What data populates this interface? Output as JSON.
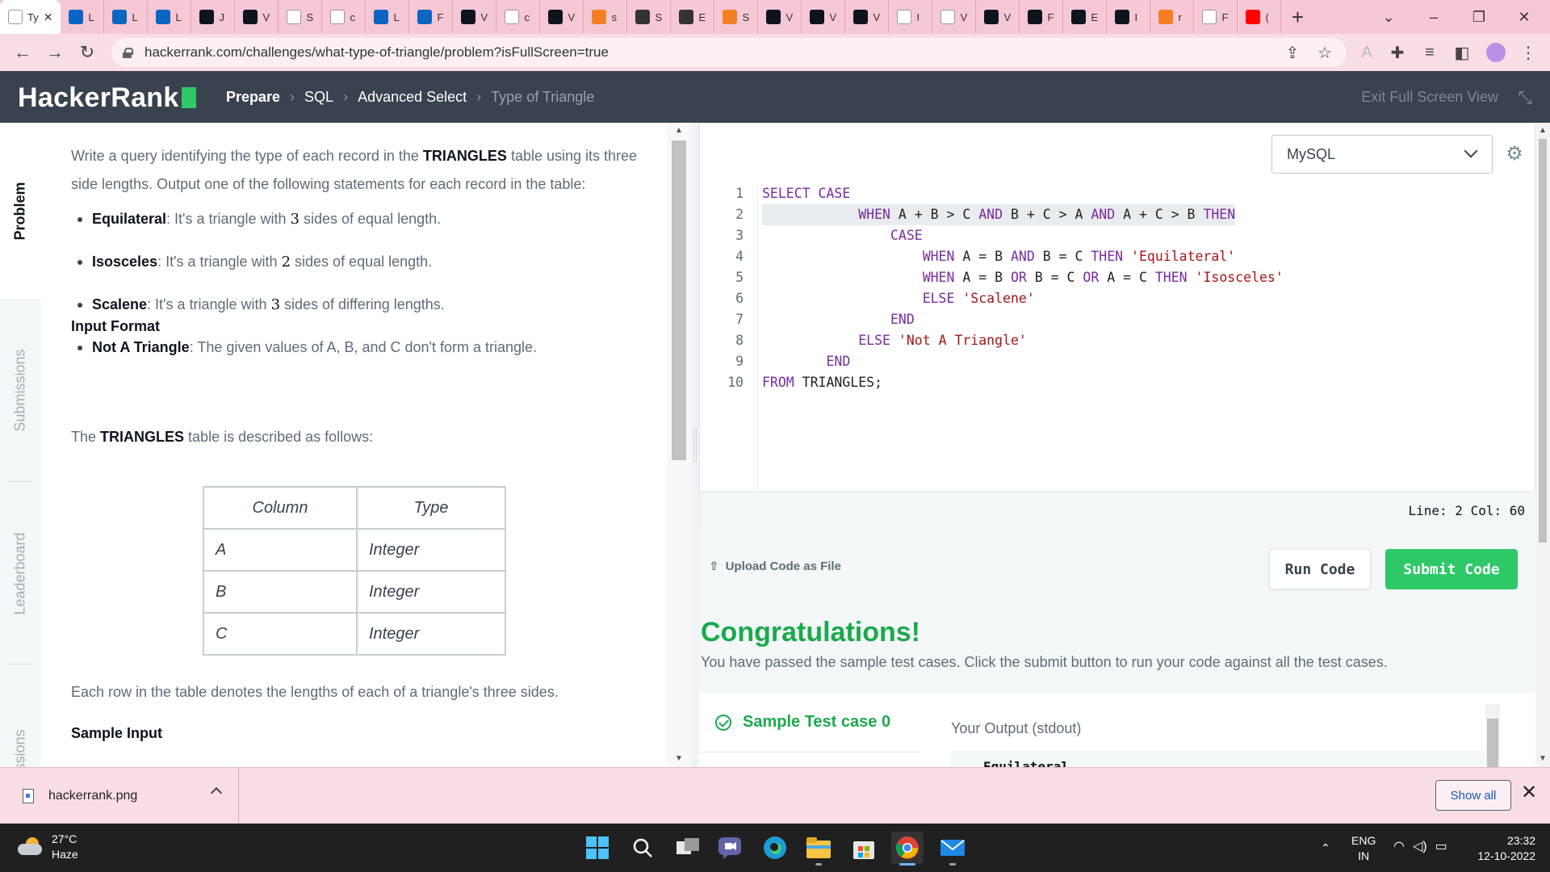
{
  "browser": {
    "tabs": [
      {
        "icon": "hackerrank-tab-icon",
        "label": "Ty",
        "color": "#ffffff",
        "active": true
      },
      {
        "icon": "linkedin-icon",
        "label": "L",
        "color": "#0a66c2"
      },
      {
        "icon": "linkedin-icon",
        "label": "L",
        "color": "#0a66c2"
      },
      {
        "icon": "linkedin-icon",
        "label": "L",
        "color": "#0a66c2"
      },
      {
        "icon": "hackerrank-icon",
        "label": "J",
        "color": "#0e141e"
      },
      {
        "icon": "hackerrank-icon",
        "label": "V",
        "color": "#0e141e"
      },
      {
        "icon": "github-icon",
        "label": "S",
        "color": "#ffffff"
      },
      {
        "icon": "google-icon",
        "label": "c",
        "color": "#ffffff"
      },
      {
        "icon": "linkedin-icon",
        "label": "L",
        "color": "#0a66c2"
      },
      {
        "icon": "linkedin-icon",
        "label": "F",
        "color": "#0a66c2"
      },
      {
        "icon": "hackerrank-icon",
        "label": "V",
        "color": "#0e141e"
      },
      {
        "icon": "google-icon",
        "label": "c",
        "color": "#ffffff"
      },
      {
        "icon": "hackerrank-icon",
        "label": "V",
        "color": "#0e141e"
      },
      {
        "icon": "stackoverflow-icon",
        "label": "s",
        "color": "#f48024"
      },
      {
        "icon": "gear-icon",
        "label": "S",
        "color": "#333333"
      },
      {
        "icon": "puzzle-icon",
        "label": "E",
        "color": "#333333"
      },
      {
        "icon": "stackoverflow-icon",
        "label": "S",
        "color": "#f48024"
      },
      {
        "icon": "hackerrank-icon",
        "label": "V",
        "color": "#0e141e"
      },
      {
        "icon": "hackerrank-icon",
        "label": "V",
        "color": "#0e141e"
      },
      {
        "icon": "hackerrank-icon",
        "label": "V",
        "color": "#0e141e"
      },
      {
        "icon": "google-icon",
        "label": "I",
        "color": "#ffffff"
      },
      {
        "icon": "google-icon",
        "label": "V",
        "color": "#ffffff"
      },
      {
        "icon": "hackerrank-icon",
        "label": "V",
        "color": "#0e141e"
      },
      {
        "icon": "hackerrank-icon",
        "label": "F",
        "color": "#0e141e"
      },
      {
        "icon": "hackerrank-icon",
        "label": "E",
        "color": "#0e141e"
      },
      {
        "icon": "hackerrank-icon",
        "label": "I",
        "color": "#0e141e"
      },
      {
        "icon": "stackoverflow-icon",
        "label": "r",
        "color": "#f48024"
      },
      {
        "icon": "github-icon",
        "label": "F",
        "color": "#ffffff"
      },
      {
        "icon": "youtube-icon",
        "label": "(",
        "color": "#ff0000"
      }
    ],
    "close_tab_glyph": "✕",
    "new_tab_glyph": "+",
    "url": "hackerrank.com/challenges/what-type-of-triangle/problem?isFullScreen=true"
  },
  "header": {
    "logo_text": "HackerRank",
    "breadcrumb": [
      "Prepare",
      "SQL",
      "Advanced Select",
      "Type of Triangle"
    ],
    "breadcrumb_sep": "›",
    "exit_fullscreen": "Exit Full Screen View"
  },
  "side_tabs": [
    "Problem",
    "Submissions",
    "Leaderboard",
    "Discussions"
  ],
  "problem": {
    "intro_pre": "Write a query identifying the type of each record in the ",
    "intro_table": "TRIANGLES",
    "intro_post": " table using its three side lengths. Output one of the following statements for each record in the table:",
    "items": [
      {
        "term": "Equilateral",
        "pre": ": It's a triangle with ",
        "num": "3",
        "post": " sides of equal length."
      },
      {
        "term": "Isosceles",
        "pre": ": It's a triangle with ",
        "num": "2",
        "post": " sides of equal length."
      },
      {
        "term": "Scalene",
        "pre": ": It's a triangle with ",
        "num": "3",
        "post": " sides of differing lengths."
      },
      {
        "term": "Not A Triangle",
        "pre": ": The given values of A, B, and C don't form a triangle.",
        "num": "",
        "post": ""
      }
    ],
    "input_format_heading": "Input Format",
    "table_desc_pre": "The ",
    "table_desc_name": "TRIANGLES",
    "table_desc_post": " table is described as follows:",
    "table": {
      "headers": [
        "Column",
        "Type"
      ],
      "rows": [
        [
          "A",
          "Integer"
        ],
        [
          "B",
          "Integer"
        ],
        [
          "C",
          "Integer"
        ]
      ]
    },
    "row_desc": "Each row in the table denotes the lengths of each of a triangle's three sides.",
    "sample_input_heading": "Sample Input"
  },
  "editor": {
    "language": "MySQL",
    "lines": [
      "1",
      "2",
      "3",
      "4",
      "5",
      "6",
      "7",
      "8",
      "9",
      "10"
    ],
    "status": "Line: 2 Col: 60"
  },
  "actions": {
    "upload": "Upload Code as File",
    "run": "Run Code",
    "submit": "Submit Code"
  },
  "result": {
    "title": "Congratulations!",
    "message": "You have passed the sample test cases. Click the submit button to run your code against all the test cases.",
    "testcase": "Sample Test case 0",
    "output_label": "Your Output (stdout)",
    "output_first": "Equilateral"
  },
  "downloads": {
    "file": "hackerrank.png",
    "show_all": "Show all",
    "close_glyph": "✕"
  },
  "taskbar": {
    "temp": "27°C",
    "weather": "Haze",
    "lang1": "ENG",
    "lang2": "IN",
    "time": "23:32",
    "date": "12-10-2022"
  },
  "colors": {
    "brand_green": "#2ec866",
    "success_green": "#1ba94c",
    "header_dark": "#39424e"
  }
}
